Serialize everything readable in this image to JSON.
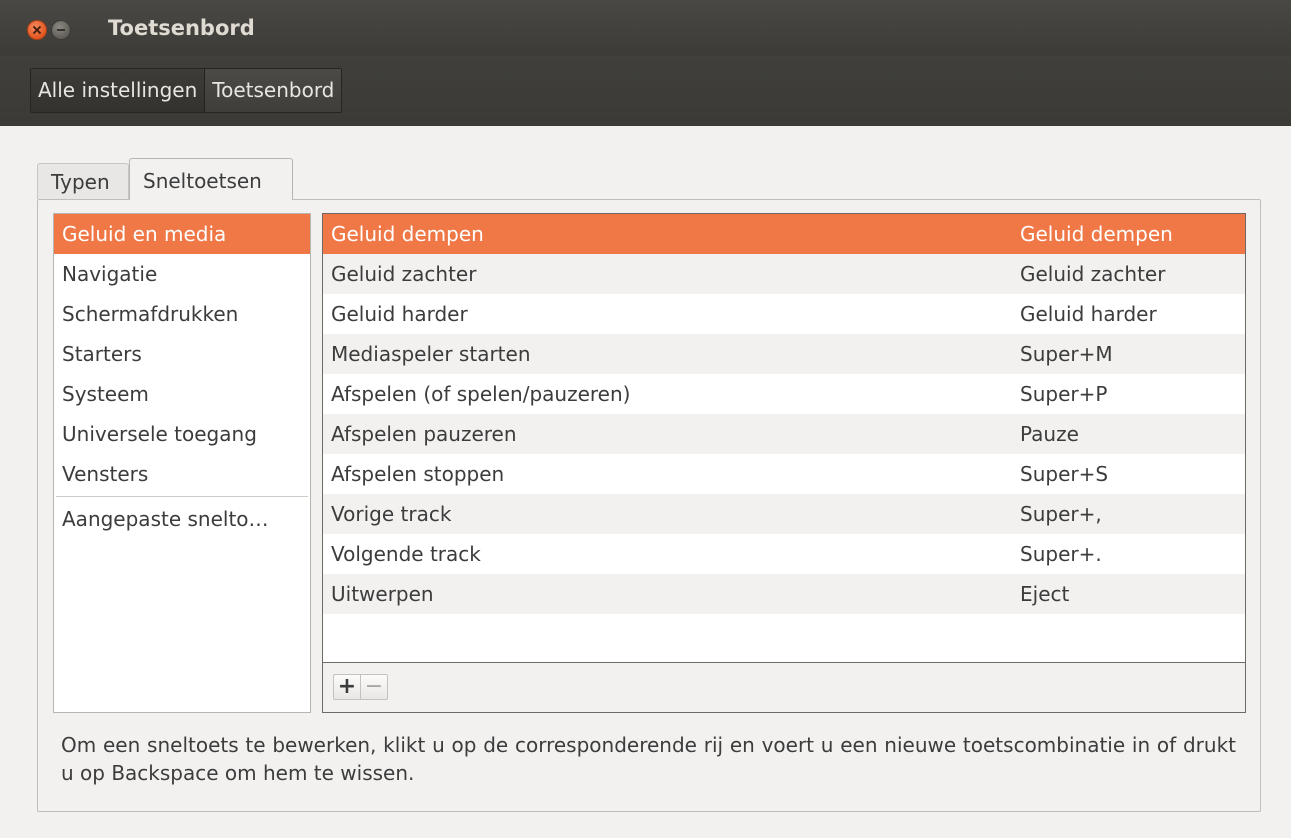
{
  "window": {
    "title": "Toetsenbord"
  },
  "breadcrumbs": [
    "Alle instellingen",
    "Toetsenbord"
  ],
  "tabs": [
    "Typen",
    "Sneltoetsen"
  ],
  "categories": {
    "items": [
      "Geluid en media",
      "Navigatie",
      "Schermafdrukken",
      "Starters",
      "Systeem",
      "Universele toegang",
      "Vensters"
    ],
    "selected": "Geluid en media",
    "custom": "Aangepaste snelto…"
  },
  "shortcuts": [
    {
      "action": "Geluid dempen",
      "accel": "Geluid dempen"
    },
    {
      "action": "Geluid zachter",
      "accel": "Geluid zachter"
    },
    {
      "action": "Geluid harder",
      "accel": "Geluid harder"
    },
    {
      "action": "Mediaspeler starten",
      "accel": "Super+M"
    },
    {
      "action": "Afspelen (of spelen/pauzeren)",
      "accel": "Super+P"
    },
    {
      "action": "Afspelen pauzeren",
      "accel": "Pauze"
    },
    {
      "action": "Afspelen stoppen",
      "accel": "Super+S"
    },
    {
      "action": "Vorige track",
      "accel": "Super+,"
    },
    {
      "action": "Volgende track",
      "accel": "Super+."
    },
    {
      "action": "Uitwerpen",
      "accel": "Eject"
    }
  ],
  "toolbar": {
    "add_label": "+",
    "remove_label": "−"
  },
  "help_text": "Om een sneltoets te bewerken, klikt u op de corresponderende rij en voert u een nieuwe toetscombinatie in of drukt u op Backspace om hem te wissen.",
  "colors": {
    "accent": "#f07746",
    "titlebar": "#3c3b37"
  }
}
